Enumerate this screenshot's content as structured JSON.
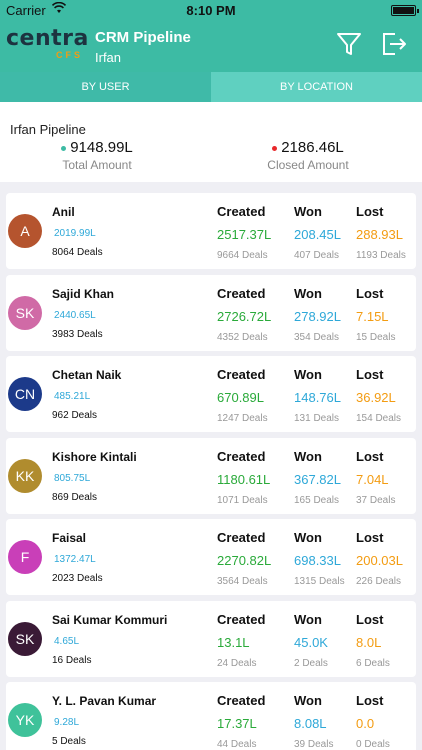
{
  "status": {
    "carrier": "Carrier",
    "time": "8:10 PM"
  },
  "header": {
    "logo_text": "centra",
    "logo_sub": "CFS",
    "title": "CRM Pipeline",
    "subtitle": "Irfan"
  },
  "tabs": [
    {
      "label": "BY USER",
      "active": true
    },
    {
      "label": "BY LOCATION",
      "active": false
    }
  ],
  "summary": {
    "title": "Irfan  Pipeline",
    "total_amount": "9148.99L",
    "total_label": "Total Amount",
    "closed_amount": "2186.46L",
    "closed_label": "Closed Amount",
    "total_dot_color": "#3dbba4",
    "closed_dot_color": "#e8282b"
  },
  "column_headers": {
    "created": "Created",
    "won": "Won",
    "lost": "Lost"
  },
  "users": [
    {
      "initials": "A",
      "name": "Anil",
      "amount": "2019.99L",
      "deals": "8064 Deals",
      "color": "#b5542e",
      "created": "2517.37L",
      "created_deals": "9664 Deals",
      "won": "208.45L",
      "won_deals": "407 Deals",
      "lost": "288.93L",
      "lost_deals": "1193 Deals"
    },
    {
      "initials": "SK",
      "name": "Sajid Khan",
      "amount": "2440.65L",
      "deals": "3983 Deals",
      "color": "#d06aa6",
      "created": "2726.72L",
      "created_deals": "4352 Deals",
      "won": "278.92L",
      "won_deals": "354 Deals",
      "lost": "7.15L",
      "lost_deals": "15 Deals"
    },
    {
      "initials": "CN",
      "name": "Chetan Naik",
      "amount": "485.21L",
      "deals": "962 Deals",
      "color": "#1c3a8a",
      "created": "670.89L",
      "created_deals": "1247 Deals",
      "won": "148.76L",
      "won_deals": "131 Deals",
      "lost": "36.92L",
      "lost_deals": "154 Deals"
    },
    {
      "initials": "KK",
      "name": "Kishore Kintali",
      "amount": "805.75L",
      "deals": "869 Deals",
      "color": "#b08c2e",
      "created": "1180.61L",
      "created_deals": "1071 Deals",
      "won": "367.82L",
      "won_deals": "165 Deals",
      "lost": "7.04L",
      "lost_deals": "37 Deals"
    },
    {
      "initials": "F",
      "name": "Faisal",
      "amount": "1372.47L",
      "deals": "2023 Deals",
      "color": "#c93fb8",
      "created": "2270.82L",
      "created_deals": "3564 Deals",
      "won": "698.33L",
      "won_deals": "1315 Deals",
      "lost": "200.03L",
      "lost_deals": "226 Deals"
    },
    {
      "initials": "SK",
      "name": "Sai Kumar Kommuri",
      "amount": "4.65L",
      "deals": "16 Deals",
      "color": "#3a1a36",
      "created": "13.1L",
      "created_deals": "24 Deals",
      "won": "45.0K",
      "won_deals": "2 Deals",
      "lost": "8.0L",
      "lost_deals": "6 Deals"
    },
    {
      "initials": "YK",
      "name": "Y. L. Pavan Kumar",
      "amount": "9.28L",
      "deals": "5 Deals",
      "color": "#3fc29a",
      "created": "17.37L",
      "created_deals": "44 Deals",
      "won": "8.08L",
      "won_deals": "39 Deals",
      "lost": "0.0",
      "lost_deals": "0 Deals"
    }
  ]
}
